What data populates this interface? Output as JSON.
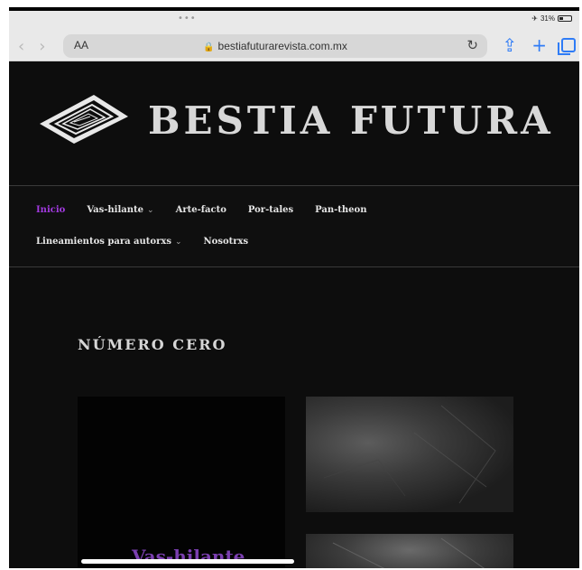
{
  "status_bar": {
    "dots": "•••",
    "airplane_icon": "airplane-icon",
    "battery_percent": "31%",
    "battery_level": 0.31
  },
  "browser": {
    "text_size_label": "AA",
    "url": "bestiafuturarevista.com.mx",
    "icons": [
      "back-icon",
      "forward-icon",
      "lock-icon",
      "reload-icon",
      "share-icon",
      "new-tab-icon",
      "tabs-icon"
    ],
    "accent_color": "#2f7cf6"
  },
  "site": {
    "title": "BESTIA FUTURA",
    "nav_row1": [
      {
        "label": "Inicio",
        "active": true,
        "dropdown": false
      },
      {
        "label": "Vas-hilante",
        "active": false,
        "dropdown": true
      },
      {
        "label": "Arte-facto",
        "active": false,
        "dropdown": false
      },
      {
        "label": "Por-tales",
        "active": false,
        "dropdown": false
      },
      {
        "label": "Pan-theon",
        "active": false,
        "dropdown": false
      }
    ],
    "nav_row2": [
      {
        "label": "Lineamientos para autorxs",
        "active": false,
        "dropdown": true
      },
      {
        "label": "Nosotrxs",
        "active": false,
        "dropdown": false
      }
    ],
    "section_title": "NÚMERO CERO",
    "card_label": "Vas-hilante",
    "active_color": "#a23ae0",
    "card_label_color": "#7b3fb0"
  }
}
